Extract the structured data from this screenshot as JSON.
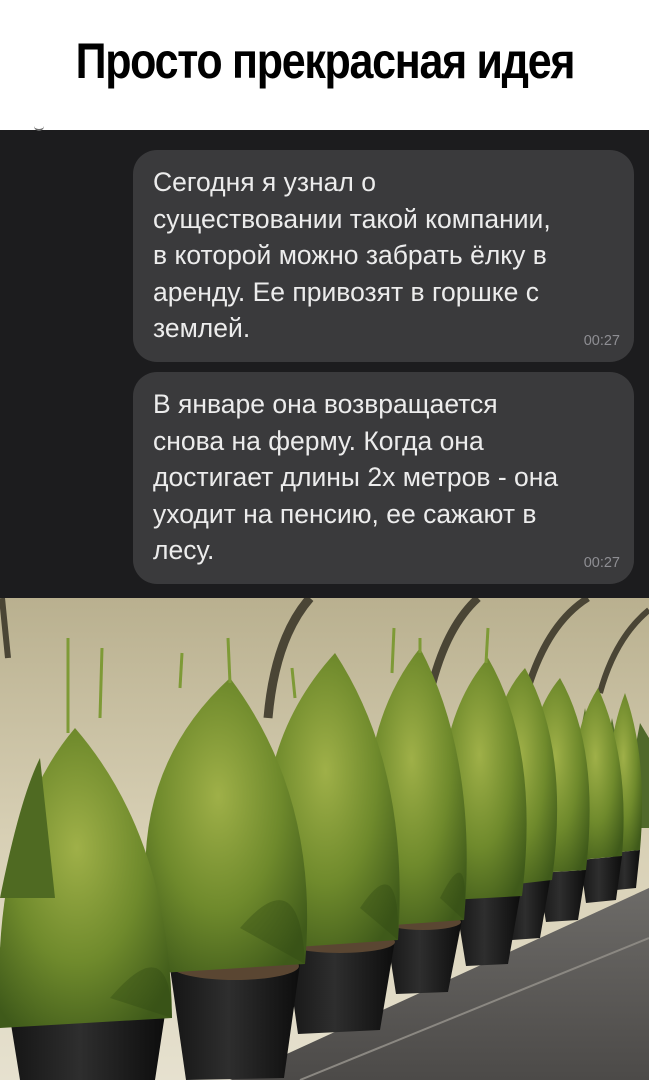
{
  "caption": {
    "title": "Просто прекрасная идея"
  },
  "chat": {
    "messages": [
      {
        "text": "Сегодня я узнал о\nсуществовании такой компании,\nв которой можно забрать ёлку в\nаренду. Ее привозят в горшке с\nземлей.",
        "time": "00:27"
      },
      {
        "text": "В январе она возвращается\nснова на ферму. Когда она\nдостигает длины 2х метров - она\nуходит на пенсию, ее сажают в\nлесу.",
        "time": "00:27"
      }
    ]
  },
  "photo": {
    "subject": "potted-spruce-trees-in-greenhouse"
  },
  "colors": {
    "chat_background": "#1c1c1e",
    "bubble": "#3a3a3c",
    "bubble_text": "#ececec",
    "timestamp": "#8e8e93",
    "caption_background": "#ffffff",
    "caption_text": "#000000"
  }
}
